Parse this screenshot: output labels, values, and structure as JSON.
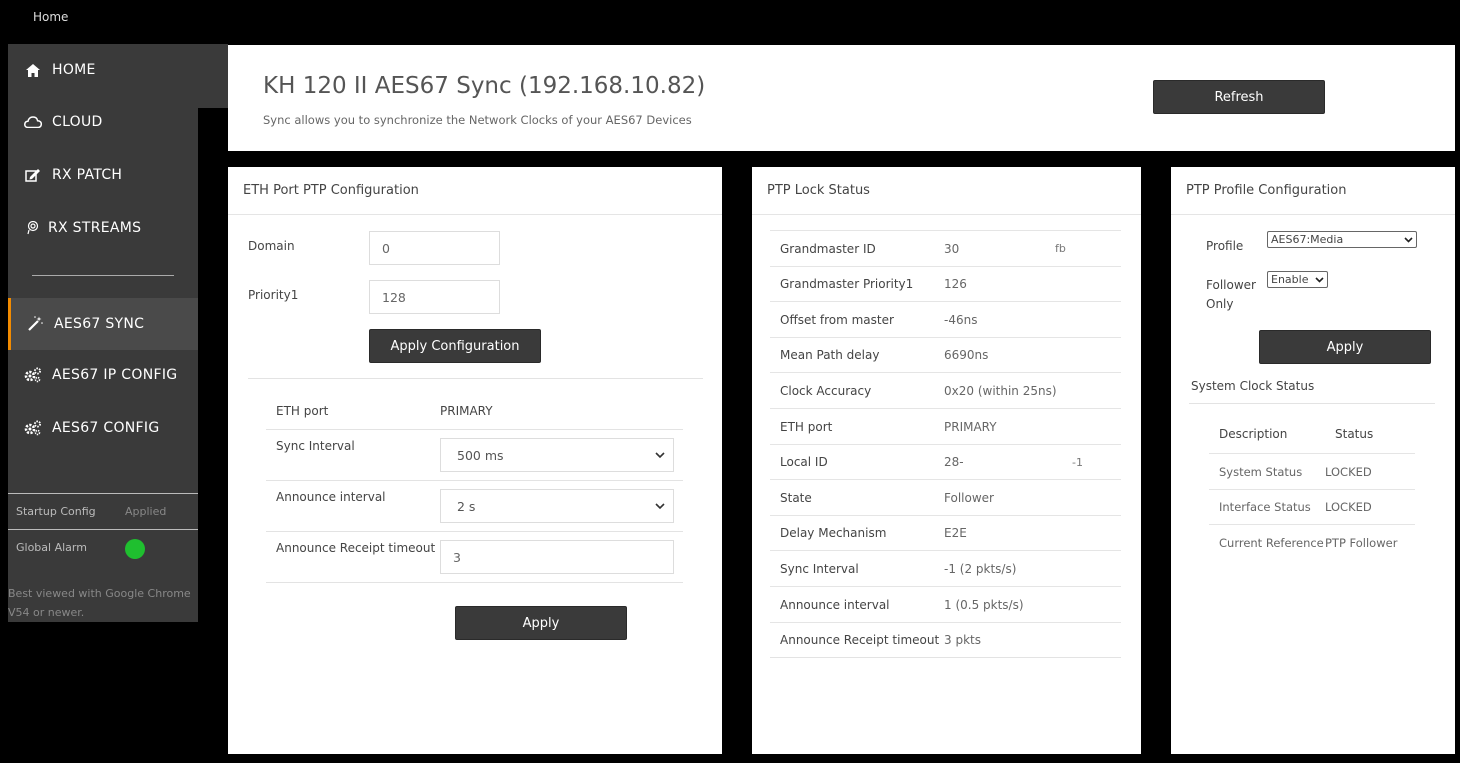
{
  "breadcrumb": "Home",
  "sidebar": {
    "items": [
      {
        "label": "HOME",
        "icon": "home-icon"
      },
      {
        "label": "CLOUD",
        "icon": "cloud-icon"
      },
      {
        "label": "RX PATCH",
        "icon": "edit-icon"
      },
      {
        "label": "RX STREAMS",
        "icon": "stream-icon"
      },
      {
        "label": "AES67 SYNC",
        "icon": "magic-wand-icon"
      },
      {
        "label": "AES67 IP CONFIG",
        "icon": "cogs-icon"
      },
      {
        "label": "AES67 CONFIG",
        "icon": "cogs-icon"
      }
    ],
    "active_color": "#f28b00",
    "startup_config": {
      "label": "Startup Config",
      "value": "Applied"
    },
    "global_alarm": {
      "label": "Global Alarm",
      "status_color": "#1fbf2f"
    },
    "best_viewed": "Best viewed with Google Chrome V54 or newer."
  },
  "header": {
    "title": "KH 120 II AES67 Sync (192.168.10.82)",
    "subtitle": "Sync allows you to synchronize the Network Clocks of your AES67 Devices",
    "refresh_label": "Refresh"
  },
  "eth_config": {
    "title": "ETH Port PTP Configuration",
    "domain_label": "Domain",
    "domain_value": "0",
    "priority_label": "Priority1",
    "priority_value": "128",
    "apply_config_label": "Apply Configuration",
    "eth_port_label": "ETH port",
    "eth_port_value": "PRIMARY",
    "sync_interval_label": "Sync Interval",
    "sync_interval_value": "500 ms",
    "announce_interval_label": "Announce interval",
    "announce_interval_value": "2 s",
    "announce_timeout_label": "Announce Receipt timeout",
    "announce_timeout_value": "3",
    "apply_label": "Apply"
  },
  "lock_status": {
    "title": "PTP Lock Status",
    "rows": [
      {
        "k": "Grandmaster ID",
        "v": "30",
        "v2": "fb"
      },
      {
        "k": "Grandmaster Priority1",
        "v": "126",
        "v2": ""
      },
      {
        "k": "Offset from master",
        "v": "-46ns",
        "v2": ""
      },
      {
        "k": "Mean Path delay",
        "v": "6690ns",
        "v2": ""
      },
      {
        "k": "Clock Accuracy",
        "v": "0x20 (within 25ns)",
        "v2": ""
      },
      {
        "k": "ETH port",
        "v": "PRIMARY",
        "v2": ""
      },
      {
        "k": "Local ID",
        "v": "28-",
        "v2": "-1"
      },
      {
        "k": "State",
        "v": "Follower",
        "v2": ""
      },
      {
        "k": "Delay Mechanism",
        "v": "E2E",
        "v2": ""
      },
      {
        "k": "Sync Interval",
        "v": "-1 (2 pkts/s)",
        "v2": ""
      },
      {
        "k": "Announce interval",
        "v": "1 (0.5 pkts/s)",
        "v2": ""
      },
      {
        "k": "Announce Receipt timeout",
        "v": "3 pkts",
        "v2": ""
      }
    ]
  },
  "profile": {
    "title": "PTP Profile Configuration",
    "profile_label": "Profile",
    "profile_value": "AES67:Media",
    "follower_label_1": "Follower",
    "follower_label_2": "Only",
    "follower_value": "Enable",
    "apply_label": "Apply",
    "clock_title": "System Clock Status",
    "col_description": "Description",
    "col_status": "Status",
    "rows": [
      {
        "k": "System Status",
        "v": "LOCKED"
      },
      {
        "k": "Interface Status",
        "v": "LOCKED"
      },
      {
        "k": "Current Reference",
        "v": "PTP Follower"
      }
    ]
  }
}
